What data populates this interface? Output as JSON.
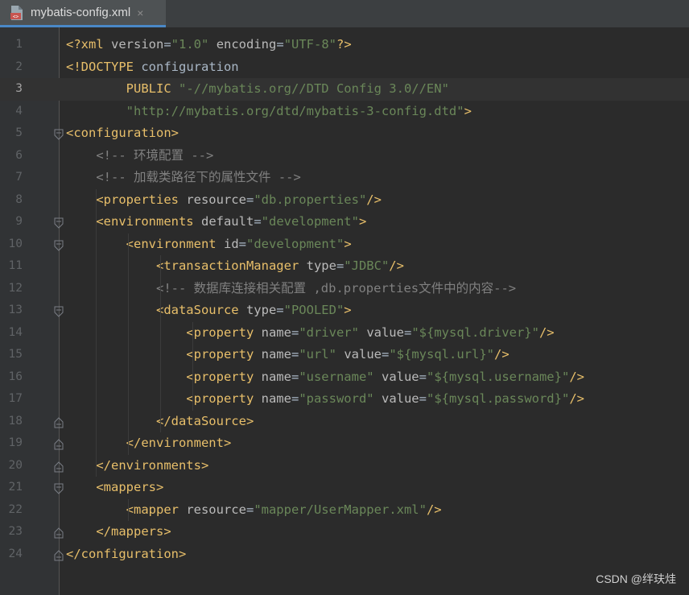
{
  "tab": {
    "title": "mybatis-config.xml",
    "close": "×",
    "icon": "xml-file-icon"
  },
  "current_line": 3,
  "lines": [
    {
      "n": "1",
      "tokens": [
        [
          "tag",
          "<?xml "
        ],
        [
          "attr",
          "version"
        ],
        [
          "plain",
          "="
        ],
        [
          "val",
          "\"1.0\""
        ],
        [
          "plain",
          " "
        ],
        [
          "attr",
          "encoding"
        ],
        [
          "plain",
          "="
        ],
        [
          "val",
          "\"UTF-8\""
        ],
        [
          "tag",
          "?>"
        ]
      ]
    },
    {
      "n": "2",
      "tokens": [
        [
          "tag",
          "<!DOCTYPE "
        ],
        [
          "plain",
          "configuration"
        ]
      ]
    },
    {
      "n": "3",
      "tokens": [
        [
          "plain",
          "        "
        ],
        [
          "tag",
          "PUBLIC "
        ],
        [
          "val",
          "\"-//mybatis.org//DTD Config 3.0//EN\""
        ]
      ]
    },
    {
      "n": "4",
      "tokens": [
        [
          "plain",
          "        "
        ],
        [
          "val",
          "\"http://mybatis.org/dtd/mybatis-3-config.dtd\""
        ],
        [
          "tag",
          ">"
        ]
      ]
    },
    {
      "n": "5",
      "tokens": [
        [
          "tag",
          "<configuration>"
        ]
      ]
    },
    {
      "n": "6",
      "tokens": [
        [
          "plain",
          "    "
        ],
        [
          "comment",
          "<!-- 环境配置 -->"
        ]
      ]
    },
    {
      "n": "7",
      "tokens": [
        [
          "plain",
          "    "
        ],
        [
          "comment",
          "<!-- 加载类路径下的属性文件 -->"
        ]
      ]
    },
    {
      "n": "8",
      "tokens": [
        [
          "plain",
          "    "
        ],
        [
          "tag",
          "<properties "
        ],
        [
          "attr",
          "resource"
        ],
        [
          "plain",
          "="
        ],
        [
          "val",
          "\"db.properties\""
        ],
        [
          "tag",
          "/>"
        ]
      ]
    },
    {
      "n": "9",
      "tokens": [
        [
          "plain",
          "    "
        ],
        [
          "tag",
          "<environments "
        ],
        [
          "attr",
          "default"
        ],
        [
          "plain",
          "="
        ],
        [
          "val",
          "\"development\""
        ],
        [
          "tag",
          ">"
        ]
      ]
    },
    {
      "n": "10",
      "tokens": [
        [
          "plain",
          "        "
        ],
        [
          "tag",
          "<environment "
        ],
        [
          "attr",
          "id"
        ],
        [
          "plain",
          "="
        ],
        [
          "val",
          "\"development\""
        ],
        [
          "tag",
          ">"
        ]
      ]
    },
    {
      "n": "11",
      "tokens": [
        [
          "plain",
          "            "
        ],
        [
          "tag",
          "<transactionManager "
        ],
        [
          "attr",
          "type"
        ],
        [
          "plain",
          "="
        ],
        [
          "val",
          "\"JDBC\""
        ],
        [
          "tag",
          "/>"
        ]
      ]
    },
    {
      "n": "12",
      "tokens": [
        [
          "plain",
          "            "
        ],
        [
          "comment",
          "<!-- 数据库连接相关配置 ,db.properties文件中的内容-->"
        ]
      ]
    },
    {
      "n": "13",
      "tokens": [
        [
          "plain",
          "            "
        ],
        [
          "tag",
          "<dataSource "
        ],
        [
          "attr",
          "type"
        ],
        [
          "plain",
          "="
        ],
        [
          "val",
          "\"POOLED\""
        ],
        [
          "tag",
          ">"
        ]
      ]
    },
    {
      "n": "14",
      "tokens": [
        [
          "plain",
          "                "
        ],
        [
          "tag",
          "<property "
        ],
        [
          "attr",
          "name"
        ],
        [
          "plain",
          "="
        ],
        [
          "val",
          "\"driver\""
        ],
        [
          "plain",
          " "
        ],
        [
          "attr",
          "value"
        ],
        [
          "plain",
          "="
        ],
        [
          "val",
          "\"${mysql.driver}\""
        ],
        [
          "tag",
          "/>"
        ]
      ]
    },
    {
      "n": "15",
      "tokens": [
        [
          "plain",
          "                "
        ],
        [
          "tag",
          "<property "
        ],
        [
          "attr",
          "name"
        ],
        [
          "plain",
          "="
        ],
        [
          "val",
          "\"url\""
        ],
        [
          "plain",
          " "
        ],
        [
          "attr",
          "value"
        ],
        [
          "plain",
          "="
        ],
        [
          "val",
          "\"${mysql.url}\""
        ],
        [
          "tag",
          "/>"
        ]
      ]
    },
    {
      "n": "16",
      "tokens": [
        [
          "plain",
          "                "
        ],
        [
          "tag",
          "<property "
        ],
        [
          "attr",
          "name"
        ],
        [
          "plain",
          "="
        ],
        [
          "val",
          "\"username\""
        ],
        [
          "plain",
          " "
        ],
        [
          "attr",
          "value"
        ],
        [
          "plain",
          "="
        ],
        [
          "val",
          "\"${mysql.username}\""
        ],
        [
          "tag",
          "/>"
        ]
      ]
    },
    {
      "n": "17",
      "tokens": [
        [
          "plain",
          "                "
        ],
        [
          "tag",
          "<property "
        ],
        [
          "attr",
          "name"
        ],
        [
          "plain",
          "="
        ],
        [
          "val",
          "\"password\""
        ],
        [
          "plain",
          " "
        ],
        [
          "attr",
          "value"
        ],
        [
          "plain",
          "="
        ],
        [
          "val",
          "\"${mysql.password}\""
        ],
        [
          "tag",
          "/>"
        ]
      ]
    },
    {
      "n": "18",
      "tokens": [
        [
          "plain",
          "            "
        ],
        [
          "tag",
          "</dataSource>"
        ]
      ]
    },
    {
      "n": "19",
      "tokens": [
        [
          "plain",
          "        "
        ],
        [
          "tag",
          "</environment>"
        ]
      ]
    },
    {
      "n": "20",
      "tokens": [
        [
          "plain",
          "    "
        ],
        [
          "tag",
          "</environments>"
        ]
      ]
    },
    {
      "n": "21",
      "tokens": [
        [
          "plain",
          "    "
        ],
        [
          "tag",
          "<mappers>"
        ]
      ]
    },
    {
      "n": "22",
      "tokens": [
        [
          "plain",
          "        "
        ],
        [
          "tag",
          "<mapper "
        ],
        [
          "attr",
          "resource"
        ],
        [
          "plain",
          "="
        ],
        [
          "val",
          "\"mapper/UserMapper.xml\""
        ],
        [
          "tag",
          "/>"
        ]
      ]
    },
    {
      "n": "23",
      "tokens": [
        [
          "plain",
          "    "
        ],
        [
          "tag",
          "</mappers>"
        ]
      ]
    },
    {
      "n": "24",
      "tokens": [
        [
          "tag",
          "</configuration>"
        ]
      ]
    }
  ],
  "fold_markers": {
    "5": "open",
    "9": "open",
    "10": "open",
    "13": "open",
    "18": "close",
    "19": "close",
    "20": "close",
    "21": "open",
    "23": "close",
    "24": "close"
  },
  "watermark": "CSDN @绊玞烓",
  "colors": {
    "tag": "#e8bf6a",
    "attr": "#bababa",
    "value": "#6a8759",
    "comment": "#808080",
    "text": "#a9b7c6",
    "background": "#2b2b2b"
  }
}
